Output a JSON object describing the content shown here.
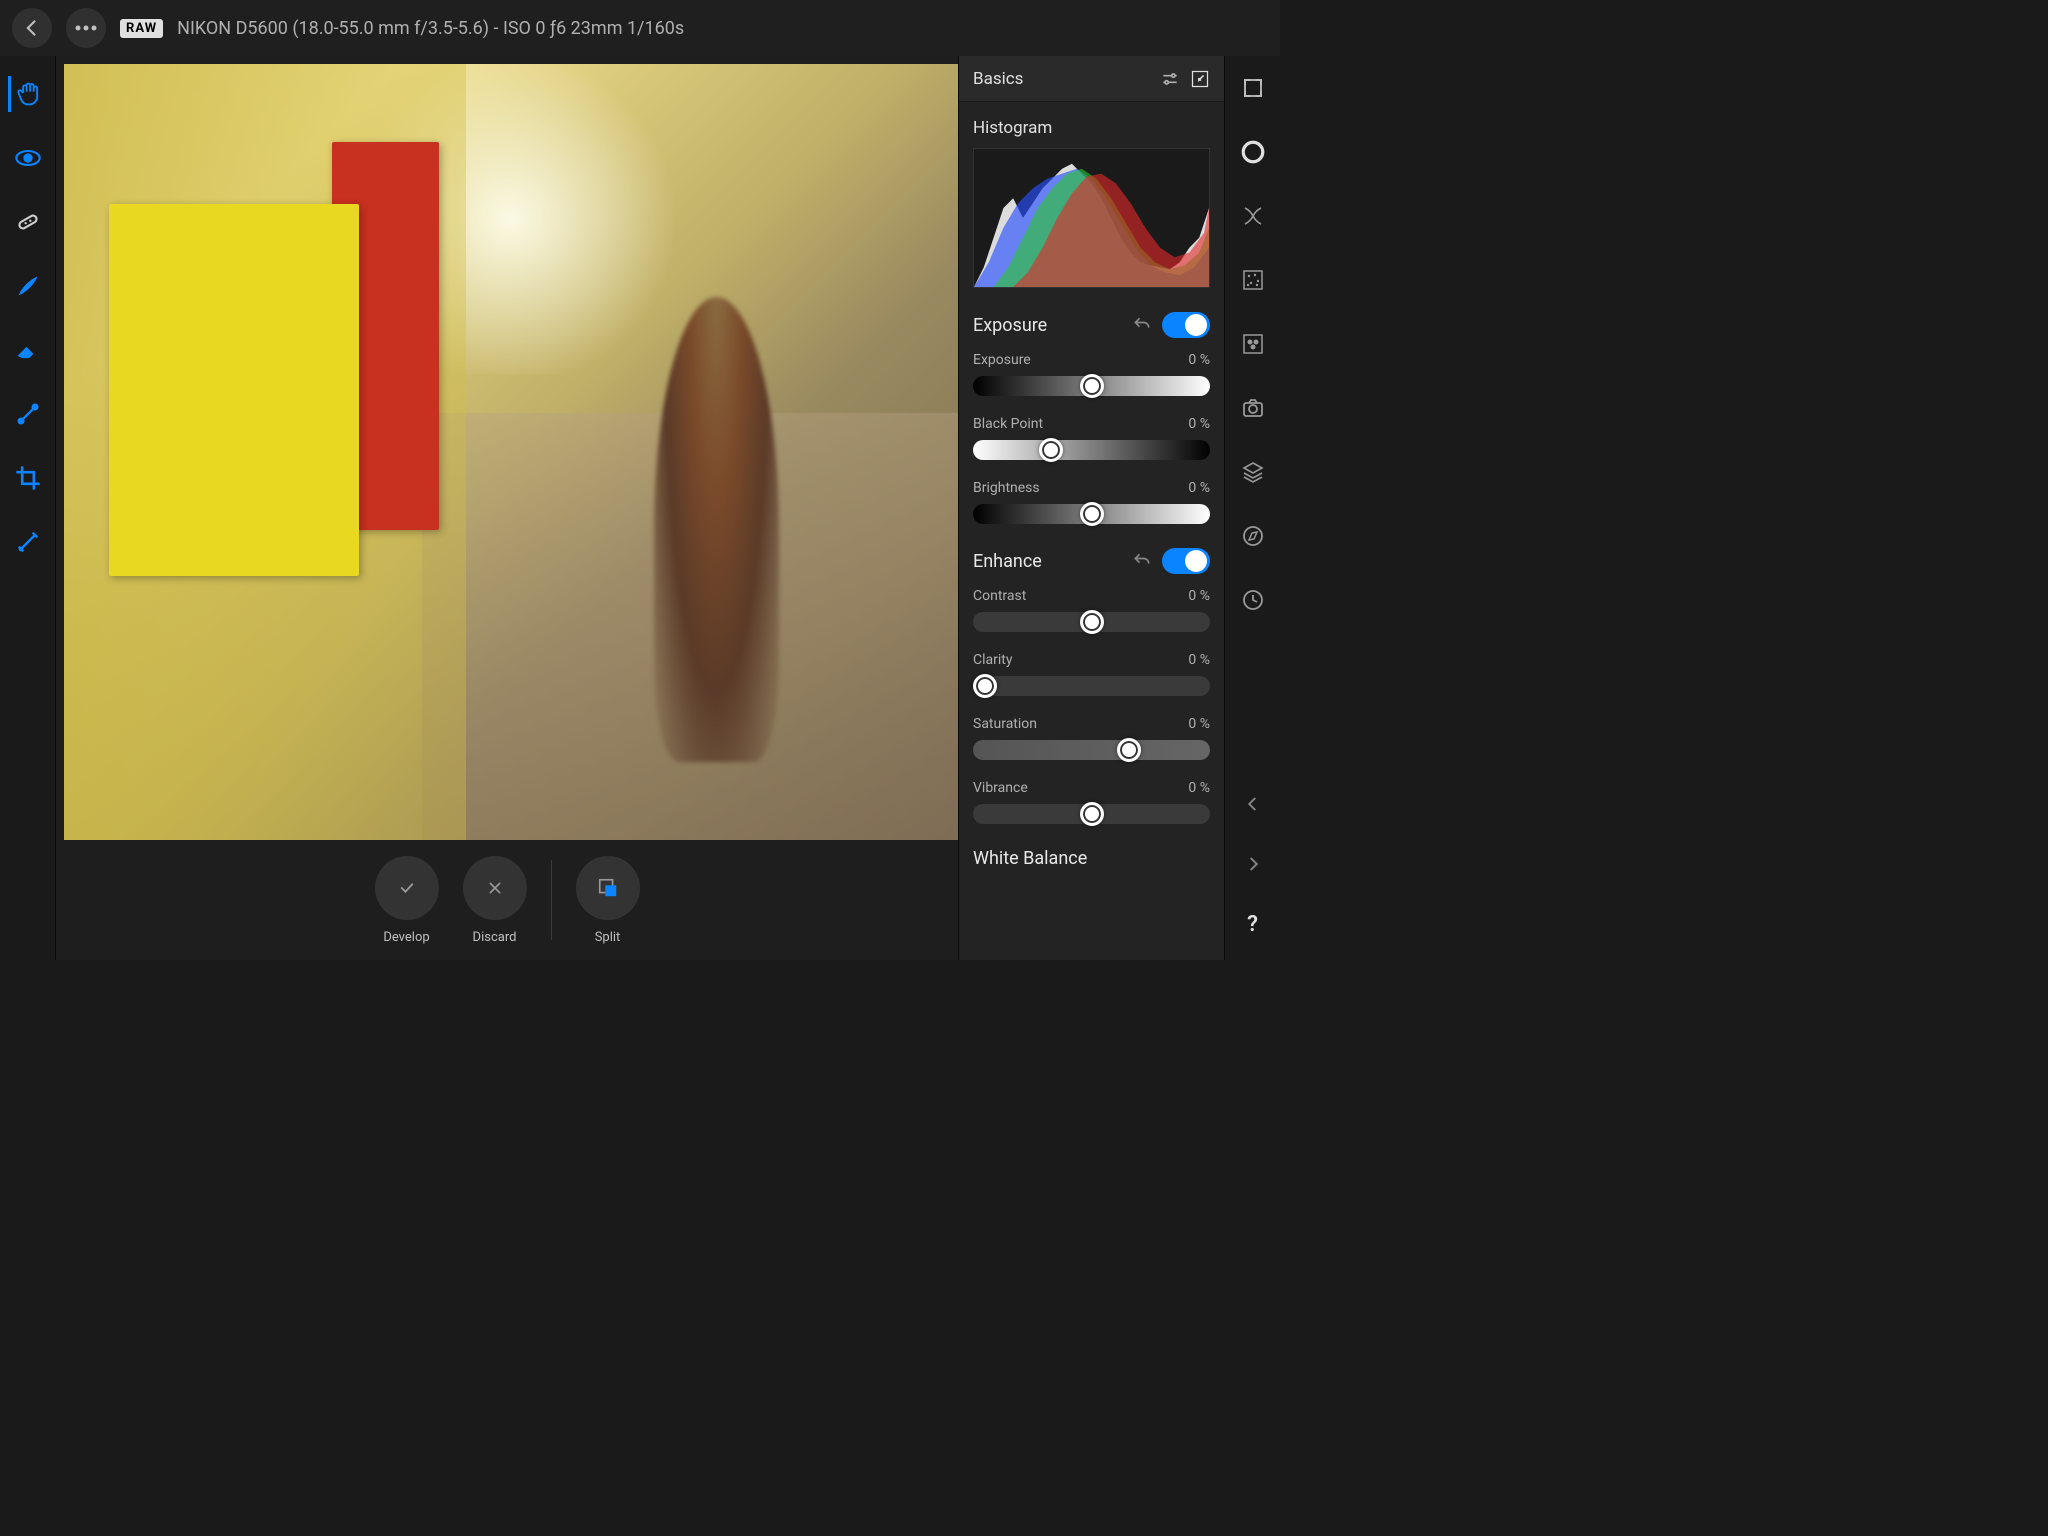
{
  "topbar": {
    "raw_badge": "RAW",
    "camera_info": "NIKON D5600 (18.0-55.0 mm f/3.5-5.6) - ISO 0 ƒ6 23mm 1/160s"
  },
  "panel": {
    "title": "Basics",
    "histogram_label": "Histogram"
  },
  "sections": {
    "exposure": {
      "title": "Exposure",
      "sliders": {
        "exposure": {
          "label": "Exposure",
          "value": "0 %",
          "pos": 50
        },
        "black_point": {
          "label": "Black Point",
          "value": "0 %",
          "pos": 33
        },
        "brightness": {
          "label": "Brightness",
          "value": "0 %",
          "pos": 50
        }
      }
    },
    "enhance": {
      "title": "Enhance",
      "sliders": {
        "contrast": {
          "label": "Contrast",
          "value": "0 %",
          "pos": 50
        },
        "clarity": {
          "label": "Clarity",
          "value": "0 %",
          "pos": 4
        },
        "saturation": {
          "label": "Saturation",
          "value": "0 %",
          "pos": 66
        },
        "vibrance": {
          "label": "Vibrance",
          "value": "0 %",
          "pos": 50
        }
      }
    },
    "white_balance": {
      "title": "White Balance"
    }
  },
  "actions": {
    "develop": "Develop",
    "discard": "Discard",
    "split": "Split"
  }
}
